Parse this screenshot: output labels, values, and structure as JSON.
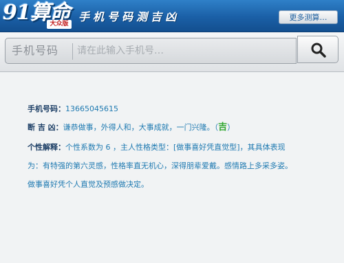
{
  "header": {
    "logo_text": "91算命",
    "logo_badge": "大众版",
    "site_title": "手机号码测吉凶",
    "more_button": "更多测算…"
  },
  "search": {
    "label": "手机号码",
    "placeholder": "请在此输入手机号…",
    "value": "",
    "button_icon": "search-icon"
  },
  "result": {
    "phone_label": "手机号码：",
    "phone_value": "13665045615",
    "fortune_label": "断 吉 凶：",
    "fortune_text": "谦恭做事，外得人和，大事成就，一门兴隆。",
    "fortune_open": "（",
    "fortune_verdict": "吉",
    "fortune_close": "）",
    "personality_label": "个性解释：",
    "personality_line1": "个性系数为 6 ，主人性格类型：[做事喜好凭直觉型]，其具体表现",
    "personality_line2": "为：有特强的第六灵感，性格率直无机心，深得朋辈爱戴。感情路上多采多姿。",
    "personality_line3": "做事喜好凭个人直觉及预感做决定。"
  },
  "colors": {
    "header_blue": "#1a5fa6",
    "label_navy": "#1d3f66",
    "text_blue": "#1f7ab1",
    "lucky_green": "#2ca52c"
  }
}
